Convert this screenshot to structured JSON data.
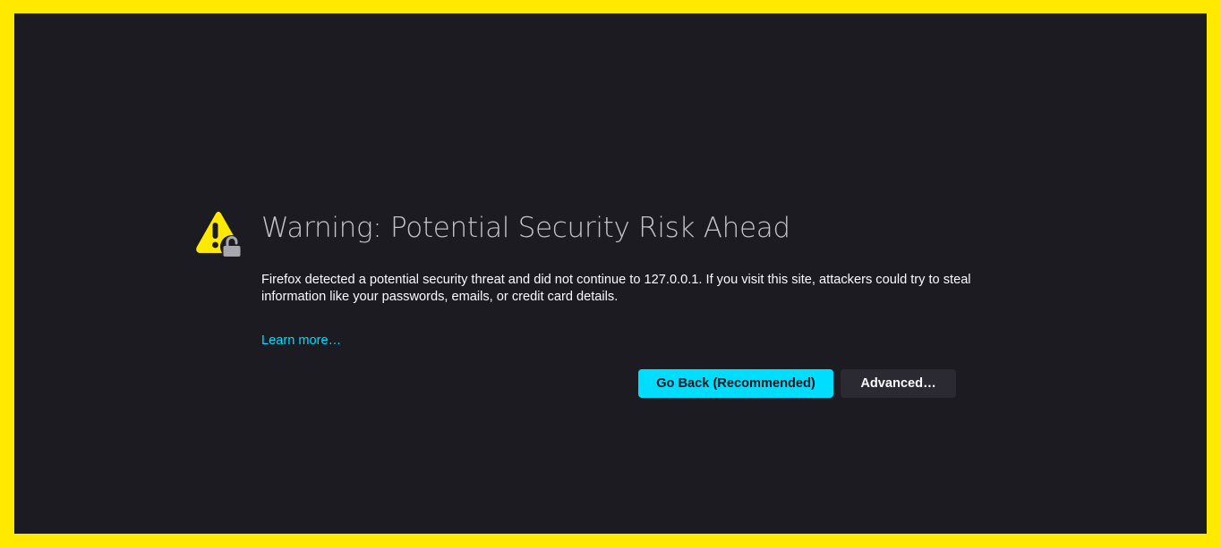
{
  "page": {
    "title": "Warning: Potential Security Risk Ahead",
    "description": "Firefox detected a potential security threat and did not continue to 127.0.0.1. If you visit this site, attackers could try to steal information like your passwords, emails, or credit card details.",
    "learn_more": "Learn more…"
  },
  "actions": {
    "go_back": "Go Back (Recommended)",
    "advanced": "Advanced…"
  },
  "icon": {
    "name": "warning-lock-icon"
  },
  "colors": {
    "page_background": "#1C1B22",
    "frame_border": "#FFE900",
    "accent": "#00DDFF",
    "warning": "#FFE900",
    "secondary_button": "#2B2A33",
    "lock": "#A8A7AE"
  }
}
